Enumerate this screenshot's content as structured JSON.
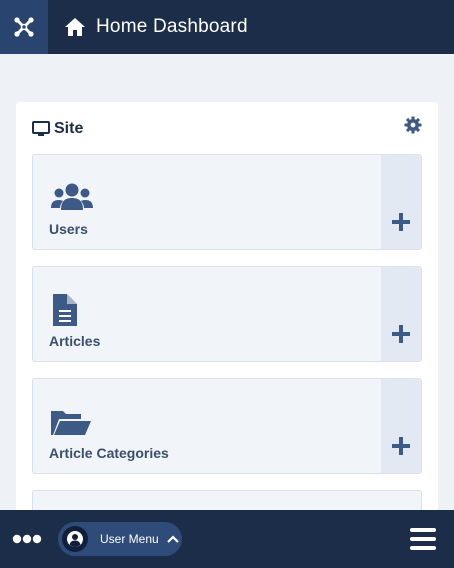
{
  "header": {
    "logo_icon": "joomla-logo-icon",
    "home_icon": "home-icon",
    "title": "Home Dashboard"
  },
  "site_card": {
    "icon": "monitor-icon",
    "title": "Site",
    "settings_icon": "gear-icon",
    "modules": [
      {
        "label": "Users",
        "icon": "users-icon",
        "action_icon": "plus-icon"
      },
      {
        "label": "Articles",
        "icon": "file-text-icon",
        "action_icon": "plus-icon"
      },
      {
        "label": "Article Categories",
        "icon": "folder-open-icon",
        "action_icon": "plus-icon"
      }
    ]
  },
  "bottom_bar": {
    "more_icon": "ellipsis-icon",
    "user_menu_label": "User Menu",
    "user_icon": "user-circle-icon",
    "chevron_icon": "chevron-up-icon",
    "menu_icon": "hamburger-icon"
  },
  "colors": {
    "header_bg": "#1c2d4a",
    "logo_bg": "#2a4470",
    "page_bg": "#eef2f7",
    "module_bg": "#f1f4f9",
    "module_action_bg": "#e2e9f3",
    "icon_color": "#3d5a86",
    "user_menu_bg": "#2f4b79"
  }
}
